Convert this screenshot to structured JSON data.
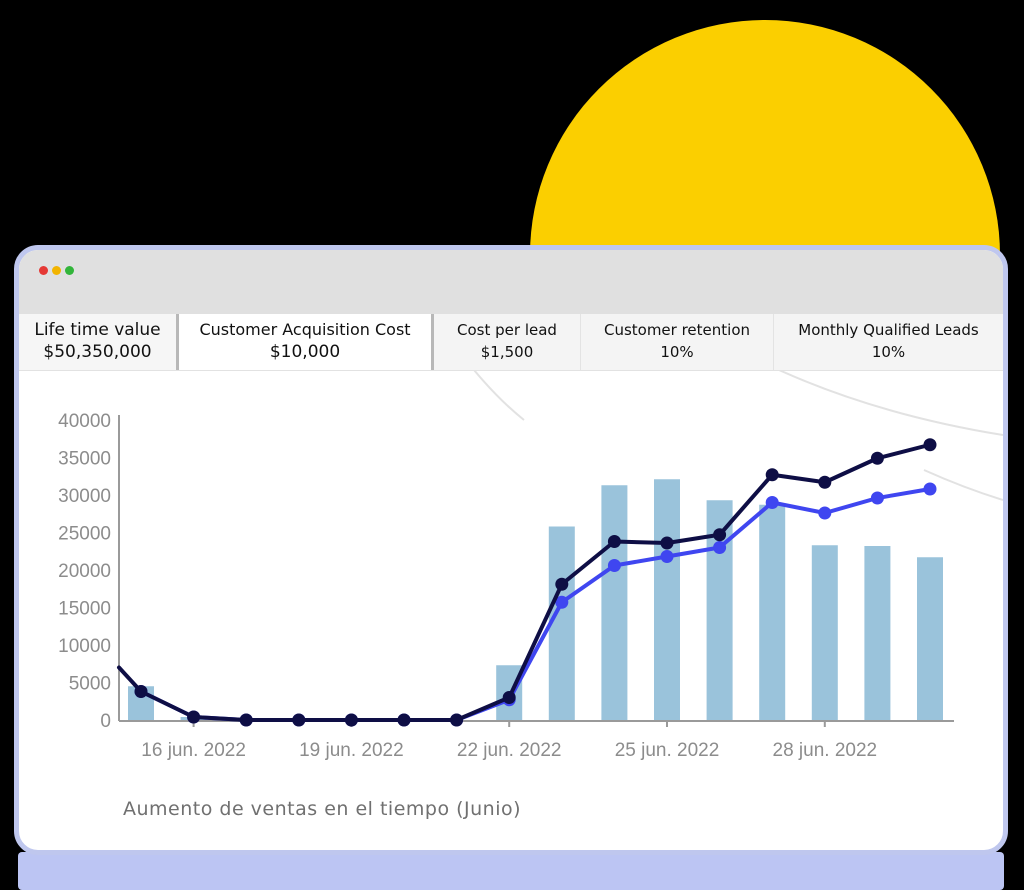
{
  "window": {
    "dots": [
      "red",
      "yellow",
      "green"
    ]
  },
  "kpis": [
    {
      "label": "Life time value",
      "value": "$50,350,000"
    },
    {
      "label": "Customer Acquisition Cost",
      "value": "$10,000"
    },
    {
      "label": "Cost per lead",
      "value": "$1,500"
    },
    {
      "label": "Customer retention",
      "value": "10%"
    },
    {
      "label": "Monthly Qualified Leads",
      "value": "10%"
    }
  ],
  "caption": "Aumento de ventas en el tiempo (Junio)",
  "colors": {
    "accent_yellow": "#FBCF00",
    "bars": "#9AC3DB",
    "line_dark": "#0E0E45",
    "line_blue": "#3F46F0",
    "frame": "#BFC7EE"
  },
  "chart_data": {
    "type": "bar",
    "x": [
      "15 jun. 2022",
      "16 jun. 2022",
      "17 jun. 2022",
      "18 jun. 2022",
      "19 jun. 2022",
      "20 jun. 2022",
      "21 jun. 2022",
      "22 jun. 2022",
      "23 jun. 2022",
      "24 jun. 2022",
      "25 jun. 2022",
      "26 jun. 2022",
      "27 jun. 2022",
      "28 jun. 2022",
      "29 jun. 2022",
      "30 jun. 2022"
    ],
    "xticks": [
      "16 jun. 2022",
      "19 jun. 2022",
      "22 jun. 2022",
      "25 jun. 2022",
      "28 jun. 2022"
    ],
    "ylim": [
      0,
      40000
    ],
    "yticks": [
      0,
      5000,
      10000,
      15000,
      20000,
      25000,
      30000,
      35000,
      40000
    ],
    "series": [
      {
        "kind": "bar",
        "values": [
          4500,
          400,
          0,
          0,
          0,
          0,
          0,
          7300,
          25800,
          31300,
          32100,
          29300,
          28700,
          23300,
          23200,
          21700
        ]
      },
      {
        "kind": "line",
        "color": "#3F46F0",
        "values": [
          3800,
          400,
          0,
          0,
          0,
          0,
          0,
          2700,
          15700,
          20600,
          21800,
          23000,
          29000,
          27600,
          29600,
          30800
        ]
      },
      {
        "kind": "line",
        "color": "#0E0E45",
        "values": [
          3800,
          400,
          0,
          0,
          0,
          0,
          0,
          3000,
          18100,
          23800,
          23600,
          24700,
          32700,
          31700,
          34900,
          36700
        ]
      }
    ],
    "caption": "Aumento de ventas en el tiempo (Junio)"
  }
}
